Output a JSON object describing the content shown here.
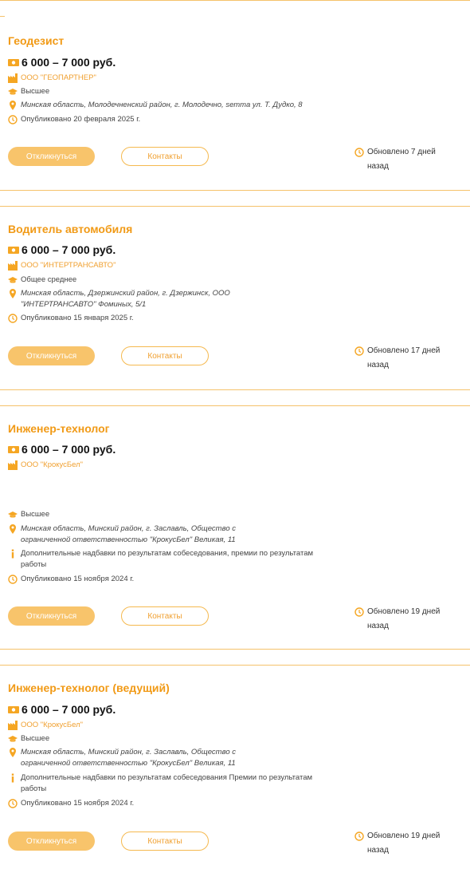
{
  "colors": {
    "accent": "#f19a16",
    "light_accent": "#f8c46b",
    "rule": "#f5c26b"
  },
  "icons": {
    "salary": "money-icon",
    "company": "factory-icon",
    "education": "graduation-cap-icon",
    "address": "location-pin-icon",
    "info": "info-icon",
    "published": "clock-icon",
    "updated": "clock-icon"
  },
  "vacancies": [
    {
      "title": "Геодезист",
      "salary": "6 000 – 7 000 руб.",
      "company": "ООО \"ГЕОПАРТНЕР\"",
      "education": "Высшее",
      "address": "Минская область, Молодечненский район, г. Молодечно, sетта ул. Т. Дудко, 8",
      "published": "Опубликовано 20 февраля 2025 г.",
      "apply_label": "Откликнуться",
      "contacts_label": "Контакты",
      "updated": "Обновлено 7 дней назад"
    },
    {
      "title": "Водитель автомобиля",
      "salary": "6 000 – 7 000 руб.",
      "company": "ООО \"ИНТЕРТРАНСАВТО\"",
      "education": "Общее среднее",
      "address": "Минская область, Дзержинский район, г. Дзержинск, ООО \"ИНТЕРТРАНСАВТО\" Фоминых, 5/1",
      "published": "Опубликовано 15 января 2025 г.",
      "apply_label": "Откликнуться",
      "contacts_label": "Контакты",
      "updated": "Обновлено 17 дней назад"
    },
    {
      "title": "Инженер-технолог",
      "salary": "6 000 – 7 000 руб.",
      "company": "ООО \"КрокусБел\"",
      "education": "Высшее",
      "address": "Минская область, Минский район, г. Заславль, Общество с ограниченной ответственностью \"КрокусБел\" Великая, 11",
      "extra": "Дополнительные надбавки по результатам собеседования, премии по результатам работы",
      "published": "Опубликовано 15 ноября 2024 г.",
      "apply_label": "Откликнуться",
      "contacts_label": "Контакты",
      "updated": "Обновлено 19 дней назад"
    },
    {
      "title": "Инженер-технолог (ведущий)",
      "salary": "6 000 – 7 000 руб.",
      "company": "ООО \"КрокусБел\"",
      "education": "Высшее",
      "address": "Минская область, Минский район, г. Заславль, Общество с ограниченной ответственностью \"КрокусБел\" Великая, 11",
      "extra": "Дополнительные надбавки по результатам собеседования Премии по результатам работы",
      "published": "Опубликовано 15 ноября 2024 г.",
      "apply_label": "Откликнуться",
      "contacts_label": "Контакты",
      "updated": "Обновлено 19 дней назад"
    }
  ]
}
